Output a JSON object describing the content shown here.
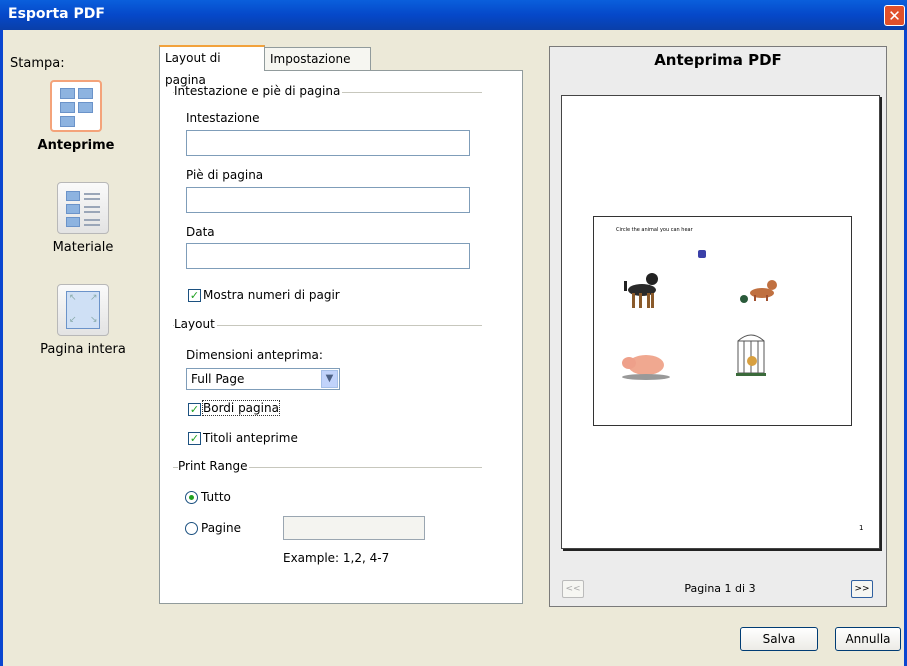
{
  "window": {
    "title": "Esporta PDF"
  },
  "sidebar": {
    "heading": "Stampa:",
    "items": [
      {
        "label": "Anteprime",
        "selected": true
      },
      {
        "label": "Materiale",
        "selected": false
      },
      {
        "label": "Pagina intera",
        "selected": false
      }
    ]
  },
  "tabs": [
    {
      "label": "Layout di pagina",
      "active": true
    },
    {
      "label": "Impostazione PDF",
      "active": false
    }
  ],
  "header_footer": {
    "group_label": "Intestazione e piè di pagina",
    "header_label": "Intestazione",
    "header_value": "",
    "footer_label": "Piè di pagina",
    "footer_value": "",
    "date_label": "Data",
    "date_value": "",
    "show_page_numbers_label": "Mostra numeri di pagir",
    "show_page_numbers_checked": true
  },
  "layout": {
    "group_label": "Layout",
    "preview_size_label": "Dimensioni anteprima:",
    "preview_size_value": "Full Page",
    "page_borders_label": "Bordi pagina",
    "page_borders_checked": true,
    "preview_titles_label": "Titoli anteprime",
    "preview_titles_checked": true
  },
  "print_range": {
    "group_label": "Print Range",
    "all_label": "Tutto",
    "pages_label": "Pagine",
    "selected": "all",
    "pages_value": "",
    "example": "Example:  1,2, 4-7"
  },
  "preview": {
    "title": "Anteprima PDF",
    "sheet_caption": "Circle the animal you can hear",
    "page_number": "1",
    "page_indicator": "Pagina 1 di 3",
    "prev_label": "<<",
    "next_label": ">>"
  },
  "buttons": {
    "save": "Salva",
    "cancel": "Annulla"
  },
  "colors": {
    "titlebar": "#0548c9",
    "accent_tab": "#f2a23c",
    "check": "#21a121"
  }
}
